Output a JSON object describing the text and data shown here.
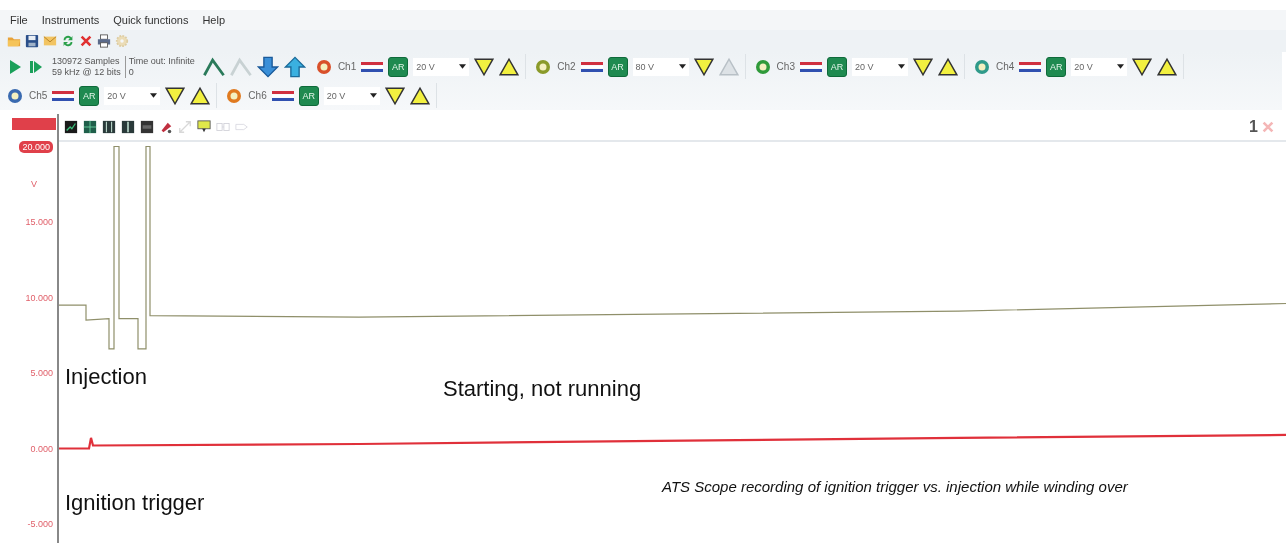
{
  "menu": [
    "File",
    "Instruments",
    "Quick functions",
    "Help"
  ],
  "file_toolbar": [
    {
      "kind": "folder",
      "disabled": false
    },
    {
      "kind": "save",
      "disabled": false
    },
    {
      "kind": "envelope",
      "disabled": false
    },
    {
      "kind": "refresh",
      "disabled": false
    },
    {
      "kind": "close",
      "disabled": false
    },
    {
      "kind": "printer",
      "disabled": false
    },
    {
      "kind": "gear",
      "disabled": true
    }
  ],
  "acquisition": {
    "samples": "130972 Samples",
    "rate": "59 kHz @ 12 bits",
    "timeout": "Time out: Infinite",
    "timeout_value": "0"
  },
  "trigger_tools": [
    {
      "kind": "rising",
      "disabled": false
    },
    {
      "kind": "falling",
      "disabled": true
    },
    {
      "kind": "down",
      "disabled": false
    },
    {
      "kind": "up",
      "disabled": false
    }
  ],
  "channels": [
    {
      "name": "Ch1",
      "color": "#d9502a",
      "coupling": "AR",
      "range": "20 V",
      "trigger_down_enabled": true,
      "trigger_up_enabled": true
    },
    {
      "name": "Ch2",
      "color": "#8a9a2a",
      "coupling": "AR",
      "range": "80 V",
      "trigger_down_enabled": true,
      "trigger_up_enabled": false
    },
    {
      "name": "Ch3",
      "color": "#2f9a3a",
      "coupling": "AR",
      "range": "20 V",
      "trigger_down_enabled": true,
      "trigger_up_enabled": true
    },
    {
      "name": "Ch4",
      "color": "#2f9a8a",
      "coupling": "AR",
      "range": "20 V",
      "trigger_down_enabled": true,
      "trigger_up_enabled": true
    },
    {
      "name": "Ch5",
      "color": "#3a6ab0",
      "coupling": "AR",
      "range": "20 V",
      "trigger_down_enabled": true,
      "trigger_up_enabled": true
    },
    {
      "name": "Ch6",
      "color": "#e07a20",
      "coupling": "AR",
      "range": "20 V",
      "trigger_down_enabled": true,
      "trigger_up_enabled": true
    }
  ],
  "scope": {
    "toolbar": [
      {
        "kind": "autoscale",
        "disabled": false
      },
      {
        "kind": "grid",
        "disabled": false
      },
      {
        "kind": "cursors",
        "disabled": false
      },
      {
        "kind": "cursor",
        "disabled": false
      },
      {
        "kind": "panel",
        "disabled": false
      },
      {
        "kind": "marker",
        "disabled": false
      },
      {
        "kind": "expand",
        "disabled": true
      },
      {
        "kind": "monitor",
        "disabled": false
      },
      {
        "kind": "link",
        "disabled": true
      },
      {
        "kind": "tag",
        "disabled": true
      }
    ],
    "window_number": "1",
    "y_axis": {
      "unit": "V",
      "labels": [
        "20.000",
        "15.000",
        "10.000",
        "5.000",
        "0.000",
        "-5.000"
      ]
    },
    "annotations": [
      "Injection",
      "Starting, not running",
      "Ignition trigger",
      "ATS Scope recording of ignition trigger vs. injection while winding over"
    ]
  }
}
